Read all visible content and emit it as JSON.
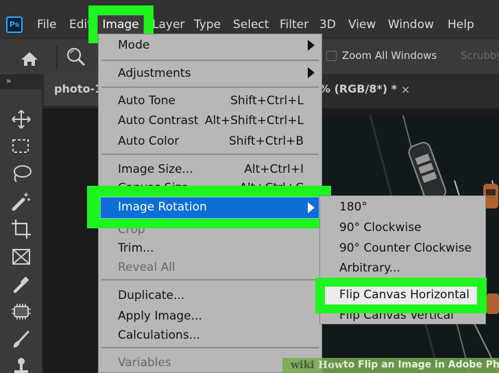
{
  "app": {
    "logo_text": "Ps"
  },
  "menubar": {
    "items": [
      "File",
      "Edit",
      "Image",
      "Layer",
      "Type",
      "Select",
      "Filter",
      "3D",
      "View",
      "Window",
      "Help"
    ],
    "active": "Image"
  },
  "options_bar": {
    "zoom_all_windows_label": "Zoom All Windows",
    "zoom_all_windows_checked": false,
    "scrubby_label": "Scrubby Zoom"
  },
  "panel": {
    "collapse_label": "»"
  },
  "tools": [
    "move-tool",
    "marquee-tool",
    "lasso-tool",
    "magic-wand-tool",
    "crop-tool",
    "frame-tool",
    "eyedropper-tool",
    "healing-tool",
    "brush-tool",
    "stamp-tool"
  ],
  "document_tab": {
    "title_start": "photo-1",
    "title_end": "% (RGB/8*) *",
    "close_glyph": "×"
  },
  "image_menu": {
    "items": [
      {
        "label": "Mode",
        "submenu": true
      },
      {
        "label": "Adjustments",
        "submenu": true
      },
      {
        "label": "Auto Tone",
        "shortcut": "Shift+Ctrl+L"
      },
      {
        "label": "Auto Contrast",
        "shortcut": "Alt+Shift+Ctrl+L"
      },
      {
        "label": "Auto Color",
        "shortcut": "Shift+Ctrl+B"
      },
      {
        "label": "Image Size...",
        "shortcut": "Alt+Ctrl+I"
      },
      {
        "label": "Canvas Size...",
        "shortcut": "Alt+Ctrl+C"
      },
      {
        "label": "Image Rotation",
        "submenu": true,
        "highlighted": true
      },
      {
        "label": "Crop",
        "disabled": true
      },
      {
        "label": "Trim..."
      },
      {
        "label": "Reveal All",
        "disabled": true
      },
      {
        "label": "Duplicate..."
      },
      {
        "label": "Apply Image..."
      },
      {
        "label": "Calculations..."
      },
      {
        "label": "Variables",
        "disabled": true,
        "submenu": true
      }
    ]
  },
  "rotation_submenu": {
    "items": [
      {
        "label": "180°"
      },
      {
        "label": "90° Clockwise"
      },
      {
        "label": "90° Counter Clockwise"
      },
      {
        "label": "Arbitrary..."
      },
      {
        "label": "Flip Canvas Horizontal",
        "highlighted": true
      },
      {
        "label": "Flip Canvas Vertical"
      }
    ]
  },
  "watermark": {
    "wiki": "wiki",
    "how": "How",
    "text": "to Flip an Image in Adobe Photoshop"
  },
  "colors": {
    "highlight_green": "#1ef51e",
    "selection_blue": "#0b6fd6",
    "menu_bg": "#b7b7b7",
    "app_bg": "#323232"
  }
}
